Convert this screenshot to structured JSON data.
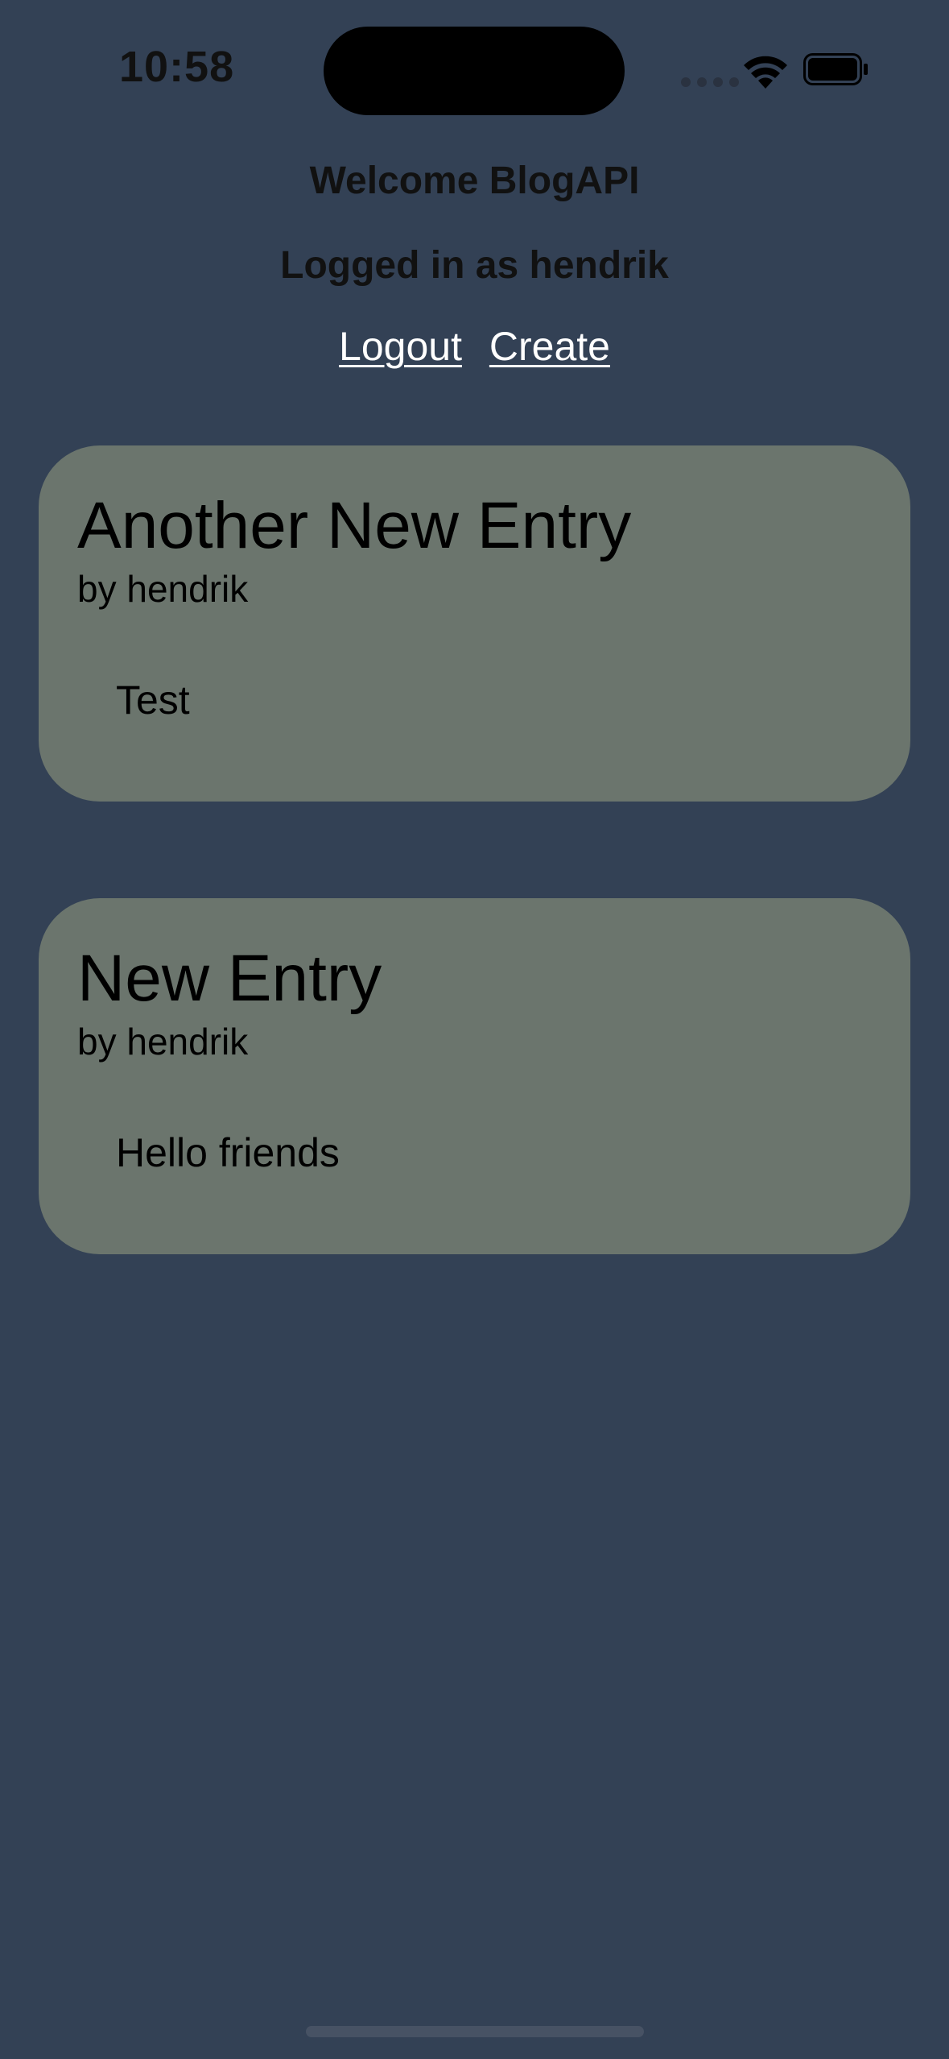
{
  "status_bar": {
    "time": "10:58"
  },
  "header": {
    "welcome": "Welcome BlogAPI",
    "logged_in": "Logged in as hendrik",
    "logout_label": "Logout",
    "create_label": "Create"
  },
  "posts": [
    {
      "title": "Another New Entry",
      "author": "by hendrik",
      "body": "Test"
    },
    {
      "title": "New Entry",
      "author": "by hendrik",
      "body": "Hello friends"
    }
  ],
  "colors": {
    "background": "#334155",
    "card": "#6b756d",
    "link": "#ffffff"
  }
}
